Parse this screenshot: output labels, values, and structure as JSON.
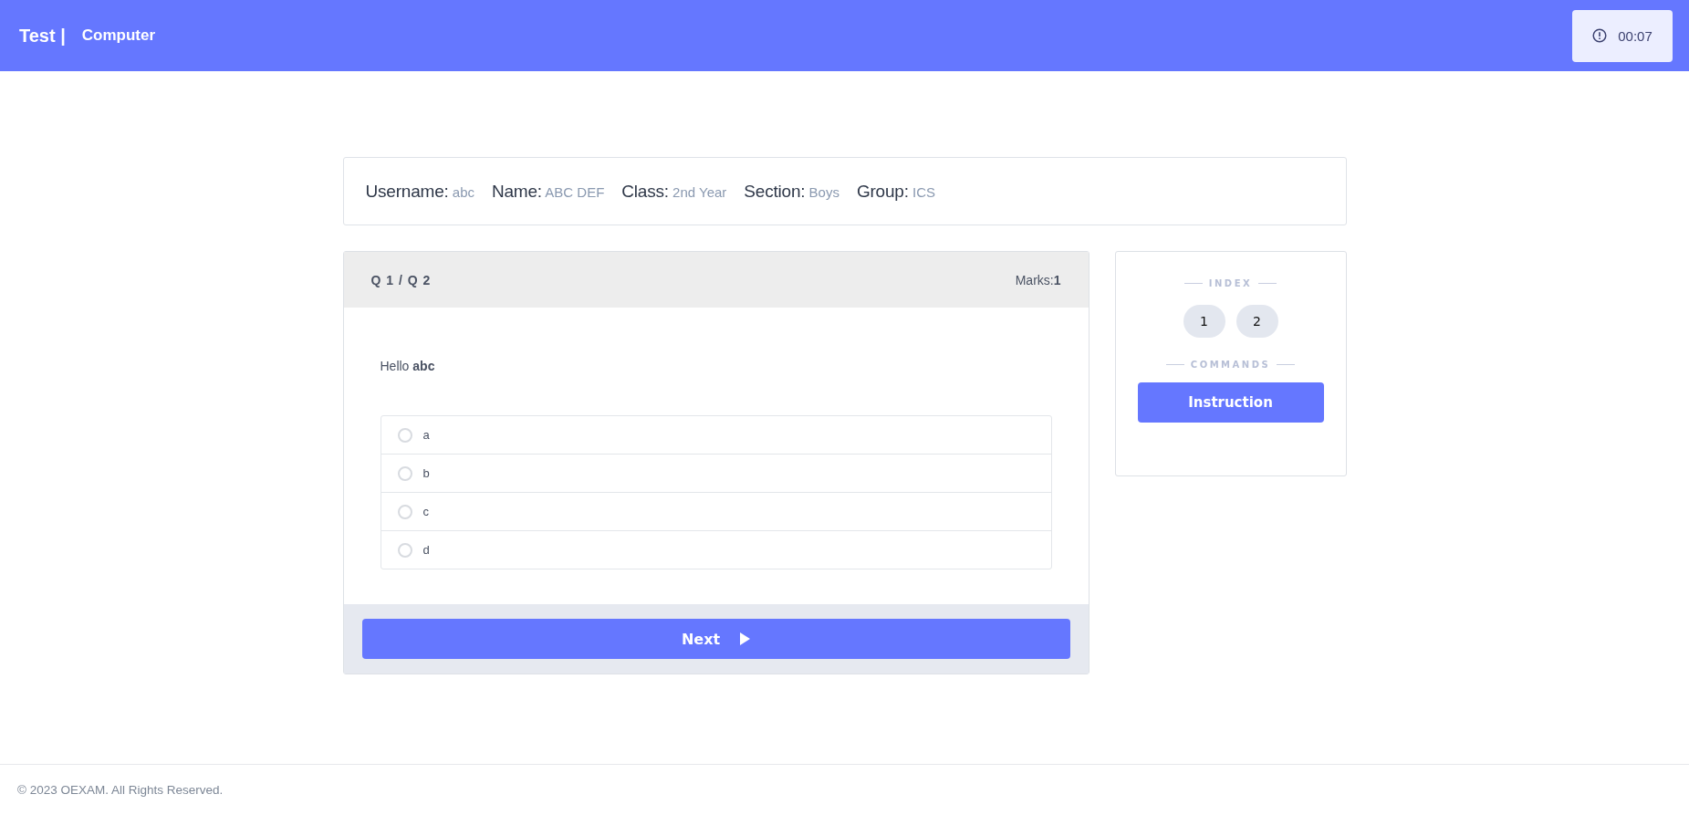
{
  "header": {
    "title": "Test |",
    "subject": "Computer",
    "timer": "00:07"
  },
  "student_info": [
    {
      "label": "Username:",
      "value": "abc"
    },
    {
      "label": "Name:",
      "value": "ABC DEF"
    },
    {
      "label": "Class:",
      "value": "2nd Year"
    },
    {
      "label": "Section:",
      "value": "Boys"
    },
    {
      "label": "Group:",
      "value": "ICS"
    }
  ],
  "question": {
    "counter": "Q 1 / Q 2",
    "marks_label": "Marks:",
    "marks": "1",
    "text": "Hello **abc**",
    "options": [
      {
        "label": "a",
        "selected": false
      },
      {
        "label": "b",
        "selected": false
      },
      {
        "label": "c",
        "selected": false
      },
      {
        "label": "d",
        "selected": false
      }
    ],
    "next_button": "Next"
  },
  "sidebar": {
    "index_heading": "INDEX",
    "index_items": [
      "1",
      "2"
    ],
    "commands_heading": "COMMANDS",
    "instruction_button": "Instruction"
  },
  "footer": "© 2023 OEXAM. All Rights Reserved."
}
